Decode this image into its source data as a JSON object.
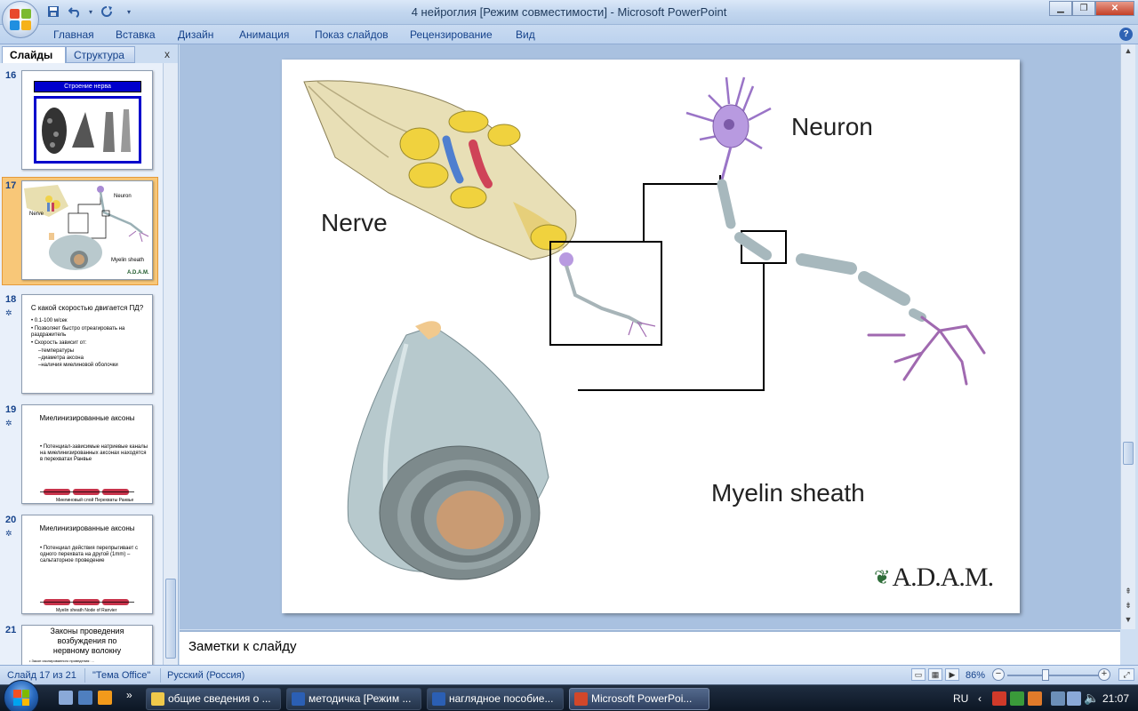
{
  "window": {
    "title": "4 нейроглия [Режим совместимости] - Microsoft PowerPoint",
    "close_icon": "close-icon",
    "colors": {
      "ribbon_text": "#15428b",
      "selected_thumb": "#f8c778",
      "taskbar": "#1a2536"
    }
  },
  "ribbon": {
    "tabs": [
      "Главная",
      "Вставка",
      "Дизайн",
      "Анимация",
      "Показ слайдов",
      "Рецензирование",
      "Вид"
    ]
  },
  "panel": {
    "tab_slides": "Слайды",
    "tab_outline": "Структура",
    "close": "x"
  },
  "slides": [
    {
      "num": "16",
      "title": "Строение нерва"
    },
    {
      "num": "17",
      "labels": {
        "neuron": "Neuron",
        "nerve": "Nerve",
        "myelin": "Myelin sheath",
        "adam": "A.D.A.M."
      }
    },
    {
      "num": "18",
      "title": "С какой скоростью двигается ПД?",
      "bullets": [
        "0.1-100 м/сек",
        "Позволяет быстро отреагировать на раздражитель",
        "Скорость зависит от:"
      ],
      "subs": [
        "–температуры",
        "–диаметра аксона",
        "–наличия миелиновой оболочки"
      ]
    },
    {
      "num": "19",
      "title": "Миелинизированные аксоны",
      "bullets": [
        "Потенциал-зависимые натриевые каналы на миелинизированных аксонах находятся в перехватах Ранвье"
      ],
      "caption": "Миелиновый слой   Перехваты Ранвье"
    },
    {
      "num": "20",
      "title": "Миелинизированные аксоны",
      "bullets": [
        "Потенциал действия перепрыгивает с одного перехвата на другой (1mm) – сальтаторное проведение"
      ],
      "caption": "Myelin sheath   Node of Ranvier"
    },
    {
      "num": "21",
      "title": "Законы проведения возбуждения по нервному волокну",
      "bullets": [
        "Закон изолированного проведения: ..."
      ]
    }
  ],
  "slide_main": {
    "label_nerve": "Nerve",
    "label_neuron": "Neuron",
    "label_myelin": "Myelin sheath",
    "logo_text": "A.D.A.M."
  },
  "notes": {
    "placeholder": "Заметки к слайду"
  },
  "status": {
    "slide": "Слайд 17 из 21",
    "theme": "\"Тема Office\"",
    "language": "Русский (Россия)",
    "zoom": "86%"
  },
  "taskbar": {
    "items": [
      "общие сведения о ...",
      "методичка [Режим ...",
      "наглядное пособие...",
      "Microsoft PowerPoi..."
    ],
    "lang": "RU",
    "clock": "21:07"
  }
}
